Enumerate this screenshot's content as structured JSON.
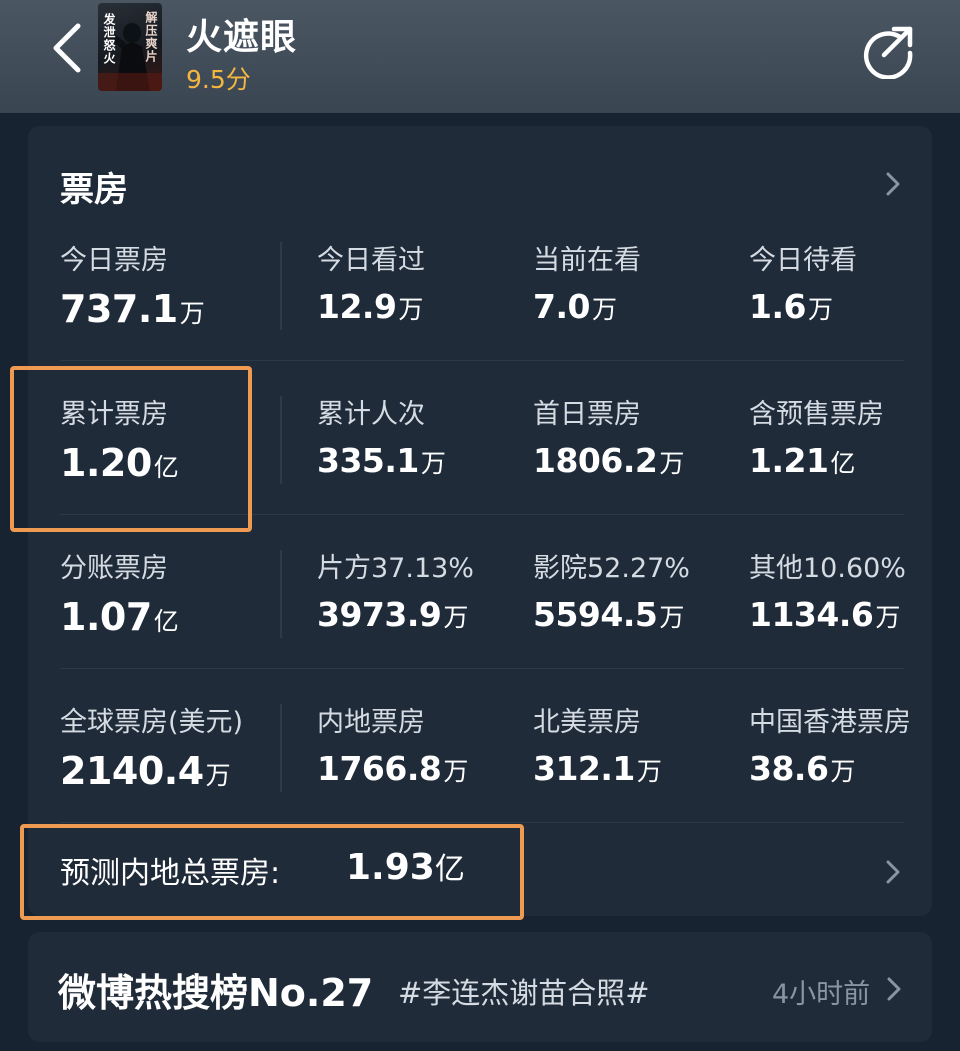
{
  "header": {
    "title": "火遮眼",
    "rating": "9.5分",
    "poster_text": {
      "left": "发泄怒火",
      "right": "解压爽片"
    }
  },
  "box_office": {
    "title": "票房",
    "rows": [
      [
        {
          "label": "今日票房",
          "number": "737.1",
          "unit": "万"
        },
        {
          "label": "今日看过",
          "number": "12.9",
          "unit": "万"
        },
        {
          "label": "当前在看",
          "number": "7.0",
          "unit": "万"
        },
        {
          "label": "今日待看",
          "number": "1.6",
          "unit": "万"
        }
      ],
      [
        {
          "label": "累计票房",
          "number": "1.20",
          "unit": "亿"
        },
        {
          "label": "累计人次",
          "number": "335.1",
          "unit": "万"
        },
        {
          "label": "首日票房",
          "number": "1806.2",
          "unit": "万"
        },
        {
          "label": "含预售票房",
          "number": "1.21",
          "unit": "亿"
        }
      ],
      [
        {
          "label": "分账票房",
          "number": "1.07",
          "unit": "亿"
        },
        {
          "label": "片方37.13%",
          "number": "3973.9",
          "unit": "万"
        },
        {
          "label": "影院52.27%",
          "number": "5594.5",
          "unit": "万"
        },
        {
          "label": "其他10.60%",
          "number": "1134.6",
          "unit": "万"
        }
      ],
      [
        {
          "label": "全球票房(美元)",
          "number": "2140.4",
          "unit": "万"
        },
        {
          "label": "内地票房",
          "number": "1766.8",
          "unit": "万"
        },
        {
          "label": "北美票房",
          "number": "312.1",
          "unit": "万"
        },
        {
          "label": "中国香港票房",
          "number": "38.6",
          "unit": "万"
        }
      ]
    ],
    "forecast": {
      "label": "预测内地总票房:",
      "number": "1.93",
      "unit": "亿"
    }
  },
  "weibo": {
    "title": "微博热搜榜No.27",
    "tag": "#李连杰谢苗合照#",
    "time": "4小时前"
  },
  "colors": {
    "background": "#172330",
    "card": "#1f2b39",
    "rating": "#f5b640",
    "highlight": "#ee9a50"
  },
  "icons": {
    "back": "chevron-left-icon",
    "share": "share-icon",
    "more": "chevron-right-icon"
  }
}
